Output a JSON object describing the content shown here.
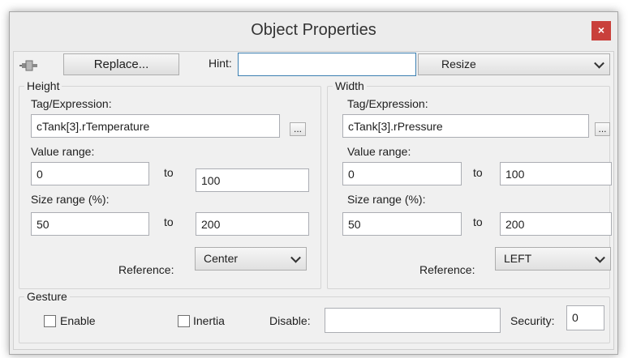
{
  "window": {
    "title": "Object Properties",
    "close_label": "×"
  },
  "toolbar": {
    "replace_label": "Replace...",
    "hint_label": "Hint:",
    "hint_value": "",
    "animation_select": "Resize"
  },
  "height": {
    "group_label": "Height",
    "tag_label": "Tag/Expression:",
    "tag_value": "cTank[3].rTemperature",
    "browse_label": "...",
    "value_range_label": "Value range:",
    "value_from": "0",
    "value_to": "100",
    "to_label": "to",
    "size_range_label": "Size range (%):",
    "size_from": "50",
    "size_to": "200",
    "reference_label": "Reference:",
    "reference_value": "Center"
  },
  "width": {
    "group_label": "Width",
    "tag_label": "Tag/Expression:",
    "tag_value": "cTank[3].rPressure",
    "browse_label": "...",
    "value_range_label": "Value range:",
    "value_from": "0",
    "value_to": "100",
    "to_label": "to",
    "size_range_label": "Size range (%):",
    "size_from": "50",
    "size_to": "200",
    "reference_label": "Reference:",
    "reference_value": "LEFT"
  },
  "gesture": {
    "group_label": "Gesture",
    "enable_label": "Enable",
    "inertia_label": "Inertia",
    "disable_label": "Disable:",
    "disable_value": "",
    "security_label": "Security:",
    "security_value": "0"
  },
  "icons": {
    "pin": "pin-icon",
    "close": "close-icon",
    "chevron": "chevron-down-icon"
  }
}
